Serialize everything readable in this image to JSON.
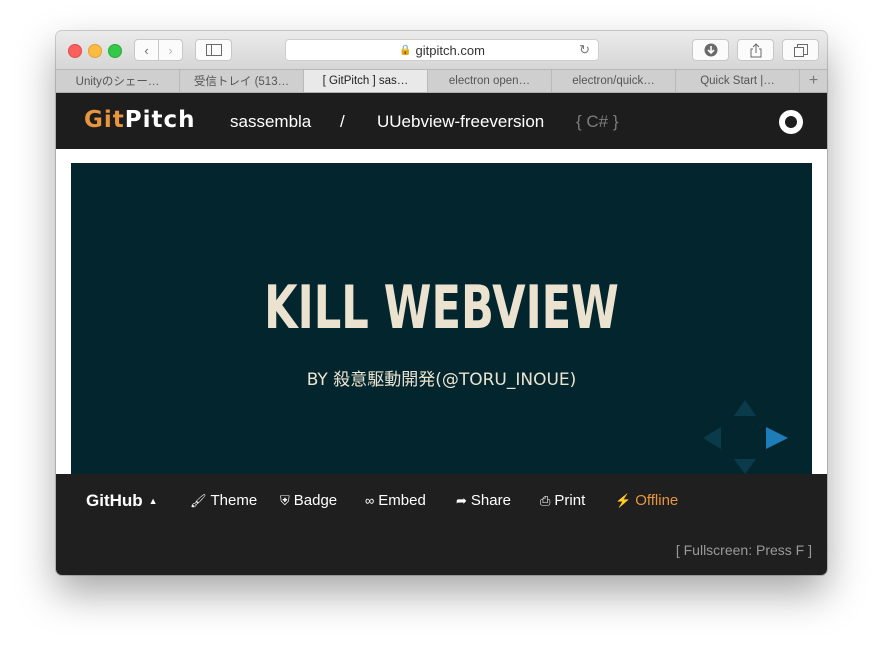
{
  "browser": {
    "address": "gitpitch.com",
    "tabs": [
      {
        "label": "Unityのシェー…"
      },
      {
        "label": "受信トレイ (513…"
      },
      {
        "label": "[ GitPitch ] sas…"
      },
      {
        "label": "electron open…"
      },
      {
        "label": "electron/quick…"
      },
      {
        "label": "Quick Start |…"
      }
    ],
    "new_tab": "+"
  },
  "header": {
    "logo_git": "Git",
    "logo_pitch": "Pitch",
    "user": "sassembla",
    "separator": "/",
    "repo": "UUebview-freeversion",
    "language": "{ C# }"
  },
  "slide": {
    "title": "KILL WEBVIEW",
    "subtitle": "BY 殺意駆動開発(@TORU_INOUE)"
  },
  "footer": {
    "github": "GitHub",
    "theme": "Theme",
    "badge": "Badge",
    "embed": "Embed",
    "share": "Share",
    "print": "Print",
    "offline": "Offline",
    "fullscreen_hint": "[ Fullscreen: Press F ]"
  },
  "colors": {
    "accent": "#e8953e",
    "slide_bg": "#03262e",
    "slide_text": "#ebe3cf",
    "header_bg": "#1d1d1d",
    "nav_arrow_active": "#1e7cb8"
  }
}
